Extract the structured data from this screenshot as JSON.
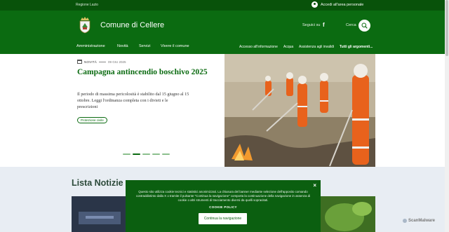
{
  "topbar": {
    "region": "Regione Lazio",
    "login": "Accedi all'area personale"
  },
  "header": {
    "title": "Comune di Cellere",
    "follow": "Seguici su",
    "search": "Cerca"
  },
  "nav": {
    "main": [
      "Amministrazione",
      "Novità",
      "Servizi",
      "Vivere il comune"
    ],
    "secondary": [
      "Accesso all'informazione",
      "Acqua",
      "Assistenza agli invalidi",
      "Tutti gli argomenti..."
    ]
  },
  "hero": {
    "tag": "NOVITÀ",
    "date": "09 GIU 2025",
    "title": "Campagna antincendio boschivo 2025",
    "description": "Il periodo di massima pericolosità è stabilito dal 15 giugno al 15 ottobre. Leggi l'ordinanza completa con i divieti e le prescrizioni",
    "chip": "Protezione civile",
    "slides": 5,
    "active_slide": 2
  },
  "section": {
    "title": "Lista Notizie"
  },
  "cookie": {
    "text": "Questo sito utilizza cookie tecnici e statistici anonimizzati. La chiusura del banner mediante selezione dell'apposito comando contraddistinto dalla X o tramite il pulsante \"Continua la navigazione\" comporta la continuazione della navigazione in assenza di cookie o altri strumenti di tracciamento diversi da quelli sopracitati.",
    "policy": "COOKIE POLICY",
    "button": "Continua la navigazione",
    "close": "×"
  },
  "watermark": "ScanMalware",
  "colors": {
    "primary": "#0b6b11",
    "topbar": "#08520a",
    "cookie": "#0b5f10"
  }
}
